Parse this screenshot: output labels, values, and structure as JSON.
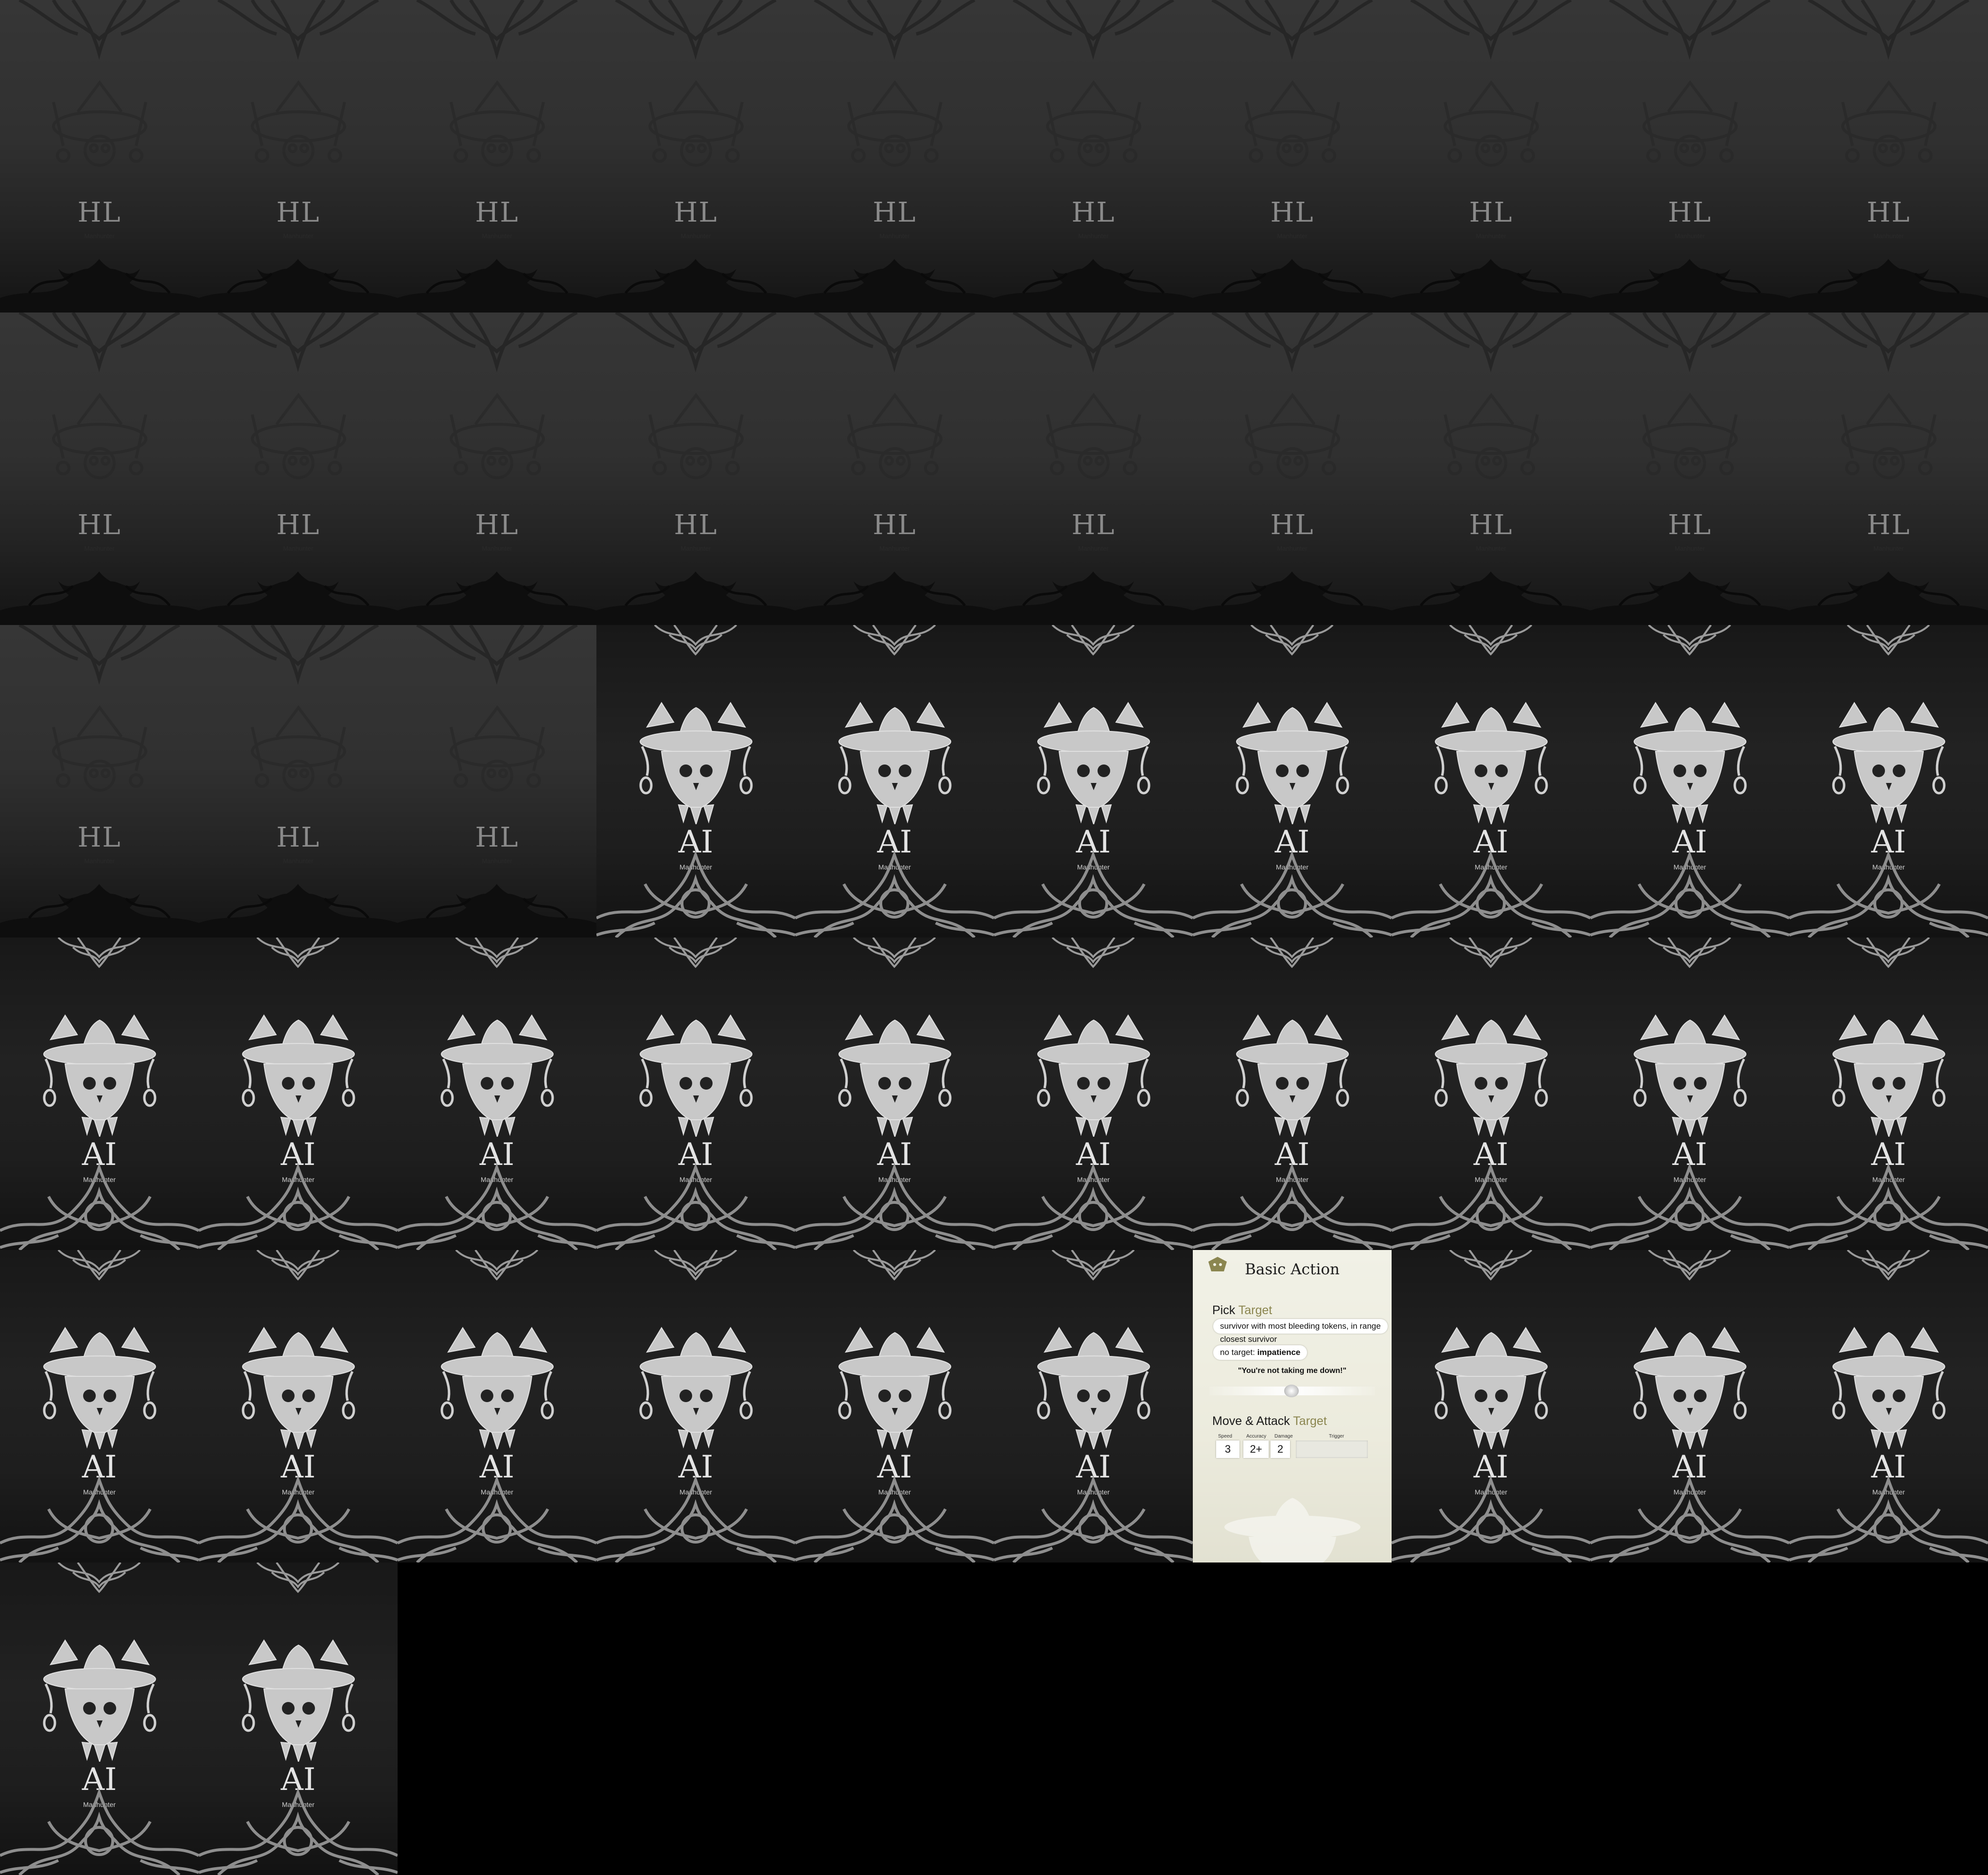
{
  "sheet": {
    "columns": 10,
    "hl_count": 23,
    "ai_count": 29
  },
  "hl_back": {
    "code": "HL",
    "monster": "Manhunter"
  },
  "ai_back": {
    "code": "AI",
    "monster": "Manhunter"
  },
  "face_card": {
    "title": "Basic Action",
    "pick": {
      "label": "Pick",
      "accent": "Target"
    },
    "targets": [
      {
        "text": "survivor with most bleeding tokens, in range",
        "bold": ""
      },
      {
        "text": "closest survivor",
        "bold": ""
      },
      {
        "text": "no target: ",
        "bold": "impatience"
      }
    ],
    "quote": "\"You're not taking me down!\"",
    "move_attack": {
      "label": "Move & Attack",
      "accent": "Target"
    },
    "stats": [
      {
        "label": "Speed",
        "value": "3"
      },
      {
        "label": "Accuracy",
        "value": "2+"
      },
      {
        "label": "Damage",
        "value": "2"
      }
    ],
    "trigger_label": "Trigger"
  },
  "colors": {
    "face_accent": "#8b8650",
    "hl_bg": "#303030",
    "ai_bg": "#1e1e1e"
  }
}
